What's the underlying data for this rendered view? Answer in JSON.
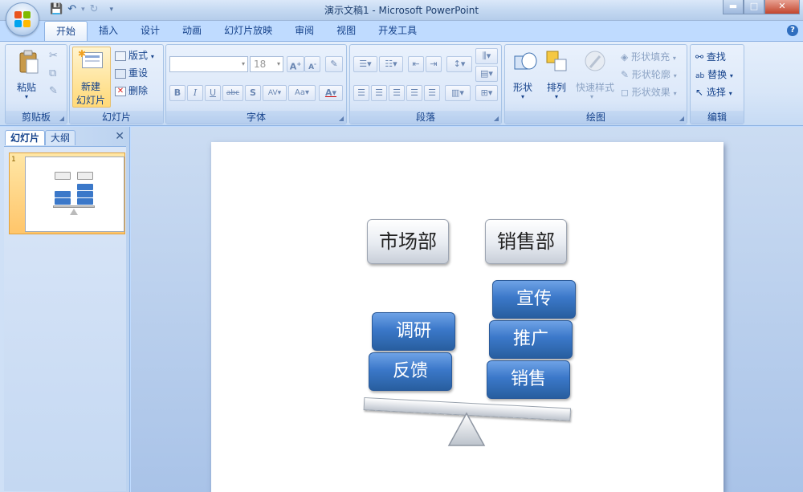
{
  "window": {
    "title": "演示文稿1 - Microsoft PowerPoint",
    "help": "?"
  },
  "tabs": [
    {
      "label": "开始",
      "active": true
    },
    {
      "label": "插入"
    },
    {
      "label": "设计"
    },
    {
      "label": "动画"
    },
    {
      "label": "幻灯片放映"
    },
    {
      "label": "审阅"
    },
    {
      "label": "视图"
    },
    {
      "label": "开发工具"
    }
  ],
  "ribbon": {
    "clipboard": {
      "label": "剪贴板",
      "paste": "粘贴"
    },
    "slides": {
      "label": "幻灯片",
      "new_slide_line1": "新建",
      "new_slide_line2": "幻灯片",
      "layout": "版式",
      "reset": "重设",
      "delete": "删除"
    },
    "font": {
      "label": "字体",
      "size": "18"
    },
    "paragraph": {
      "label": "段落"
    },
    "drawing": {
      "label": "绘图",
      "shapes": "形状",
      "arrange": "排列",
      "quick_styles": "快速样式",
      "shape_fill": "形状填充",
      "shape_outline": "形状轮廓",
      "shape_effects": "形状效果"
    },
    "editing": {
      "label": "编辑",
      "find": "查找",
      "replace": "替换",
      "select": "选择"
    }
  },
  "panel": {
    "tab_slides": "幻灯片",
    "tab_outline": "大纲",
    "close": "✕",
    "slide_number": "1"
  },
  "slide": {
    "left_header": "市场部",
    "right_header": "销售部",
    "left_items": [
      "调研",
      "反馈"
    ],
    "right_items": [
      "宣传",
      "推广",
      "销售"
    ]
  }
}
